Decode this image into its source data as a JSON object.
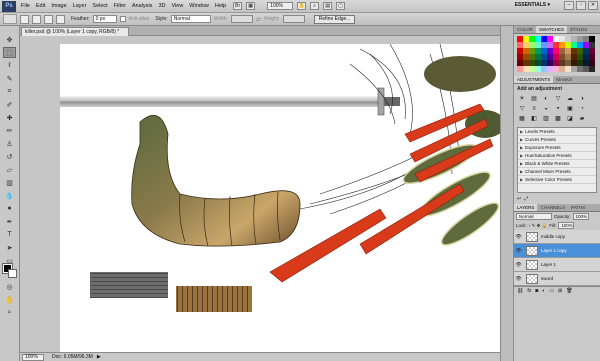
{
  "menubar": {
    "logo": "Ps",
    "items": [
      "File",
      "Edit",
      "Image",
      "Layer",
      "Select",
      "Filter",
      "Analysis",
      "3D",
      "View",
      "Window",
      "Help"
    ],
    "zoom": "100%",
    "workspace": "ESSENTIALS ▾"
  },
  "options": {
    "feather_label": "Feather:",
    "feather_value": "0 px",
    "antialias_label": "Anti-alias",
    "style_label": "Style:",
    "style_value": "Normal",
    "width_label": "Width:",
    "height_label": "Height:",
    "refine_label": "Refine Edge..."
  },
  "document": {
    "tab_title": "killer.psd @ 100% (Layer 1 copy, RGB/8) *"
  },
  "status": {
    "zoom": "100%",
    "doc": "Doc: 6.05M/96.3M"
  },
  "panels": {
    "color_tabs": [
      "COLOR",
      "SWATCHES",
      "STYLES"
    ],
    "swatch_colors": [
      "#ff0000",
      "#ffff00",
      "#00ff00",
      "#00ffff",
      "#0000ff",
      "#ff00ff",
      "#ffffff",
      "#e6e6e6",
      "#cccccc",
      "#b3b3b3",
      "#999999",
      "#808080",
      "#000000",
      "#ff6666",
      "#ffcc66",
      "#99ff66",
      "#66ffcc",
      "#6699ff",
      "#cc66ff",
      "#ff3333",
      "#ff9900",
      "#ccff00",
      "#00ff99",
      "#0099ff",
      "#9900ff",
      "#333333",
      "#cc0000",
      "#cc6600",
      "#669900",
      "#009966",
      "#0066cc",
      "#6600cc",
      "#ff0066",
      "#996633",
      "#cc9966",
      "#663300",
      "#336600",
      "#003366",
      "#660033",
      "#990000",
      "#994c00",
      "#4d7300",
      "#007349",
      "#004c99",
      "#4c0099",
      "#cc0052",
      "#7a4f29",
      "#a3784f",
      "#4d2600",
      "#264d00",
      "#00264d",
      "#4d0026",
      "#660000",
      "#663300",
      "#334d00",
      "#004d33",
      "#003366",
      "#330066",
      "#99003d",
      "#5c3b1f",
      "#7a5a3b",
      "#331a00",
      "#1a3300",
      "#001a33",
      "#33001a",
      "#ff9999",
      "#ffe0b3",
      "#ccff99",
      "#99ffe0",
      "#99c2ff",
      "#e0b3ff",
      "#ffb3d1",
      "#d9b38c",
      "#f2e0cc",
      "#a6a6a6",
      "#737373",
      "#595959",
      "#262626"
    ],
    "adj_tabs": [
      "ADJUSTMENTS",
      "MASKS"
    ],
    "adj_header": "Add an adjustment",
    "adj_icons": [
      "☀",
      "▤",
      "◐",
      "▽",
      "☁",
      "◑",
      "▽",
      "≡",
      "◒",
      "◓",
      "▣",
      "◔",
      "▦",
      "◧",
      "▨",
      "▩",
      "◪",
      "▰"
    ],
    "presets": [
      "Levels Presets",
      "Curves Presets",
      "Exposure Presets",
      "Hue/Saturation Presets",
      "Black & White Presets",
      "Channel Mixer Presets",
      "Selective Color Presets"
    ],
    "layers_tabs": [
      "LAYERS",
      "CHANNELS",
      "PATHS"
    ],
    "blend_mode": "Normal",
    "opacity_label": "Opacity:",
    "opacity_value": "100%",
    "lock_label": "Lock:",
    "fill_label": "Fill:",
    "fill_value": "100%",
    "layers": [
      {
        "name": "middle copy",
        "active": false
      },
      {
        "name": "Layer 1 copy",
        "active": true
      },
      {
        "name": "Layer 1",
        "active": false
      },
      {
        "name": "sword",
        "active": false
      }
    ]
  },
  "colors": {
    "selection_blue": "#4a90d9",
    "spike_red": "#d83a1a"
  }
}
